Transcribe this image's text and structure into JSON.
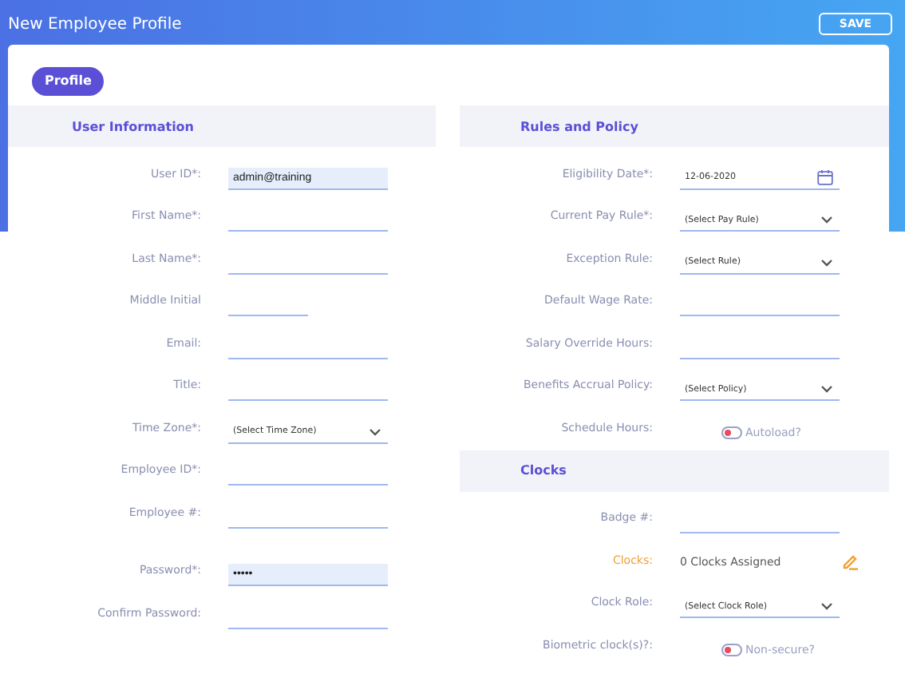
{
  "window": {
    "title": "New Employee Profile"
  },
  "save_button": "SAVE",
  "tabs": [
    {
      "label": "Profile",
      "selected": true
    }
  ],
  "columns": [
    {
      "sections": [
        {
          "title": "User Information",
          "fields": [
            {
              "kind": "text",
              "label": "User ID*:",
              "value": "admin@training"
            },
            {
              "kind": "text",
              "label": "First Name*:"
            },
            {
              "kind": "text",
              "label": "Last Name*:"
            },
            {
              "kind": "short",
              "label": "Middle Initial"
            },
            {
              "kind": "text",
              "label": "Email:"
            },
            {
              "kind": "text",
              "label": "Title:"
            },
            {
              "kind": "select",
              "label": "Time Zone*:",
              "value": "(Select Time Zone)"
            },
            {
              "kind": "text",
              "label": "Employee ID*:"
            },
            {
              "kind": "text",
              "label": "Employee #:"
            },
            {
              "kind": "password",
              "label": "Password*:",
              "value": "•••••"
            },
            {
              "kind": "text",
              "label": "Confirm Password:"
            }
          ]
        }
      ]
    },
    {
      "sections": [
        {
          "title": "Rules and Policy",
          "fields": [
            {
              "kind": "date",
              "label": "Eligibility Date*:",
              "value": "12-06-2020"
            },
            {
              "kind": "select",
              "label": "Current Pay Rule*:",
              "value": "(Select Pay Rule)"
            },
            {
              "kind": "select",
              "label": "Exception Rule:",
              "value": "(Select Rule)"
            },
            {
              "kind": "text",
              "label": "Default Wage Rate:"
            },
            {
              "kind": "text",
              "label": "Salary Override Hours:"
            },
            {
              "kind": "select",
              "label": "Benefits Accrual Policy:",
              "value": "(Select Policy)"
            },
            {
              "kind": "toggle",
              "label": "Schedule Hours:",
              "value": "Autoload?",
              "on": false
            }
          ]
        },
        {
          "title": "Clocks",
          "fields": [
            {
              "kind": "text",
              "label": "Badge #:"
            },
            {
              "kind": "info",
              "label": "Clocks:",
              "value": "0 Clocks Assigned"
            },
            {
              "kind": "select",
              "label": "Clock Role:",
              "value": "(Select Clock Role)"
            },
            {
              "kind": "toggle",
              "label": "Biometric clock(s)?:",
              "value": "Non-secure?",
              "on": false
            }
          ]
        }
      ]
    }
  ]
}
